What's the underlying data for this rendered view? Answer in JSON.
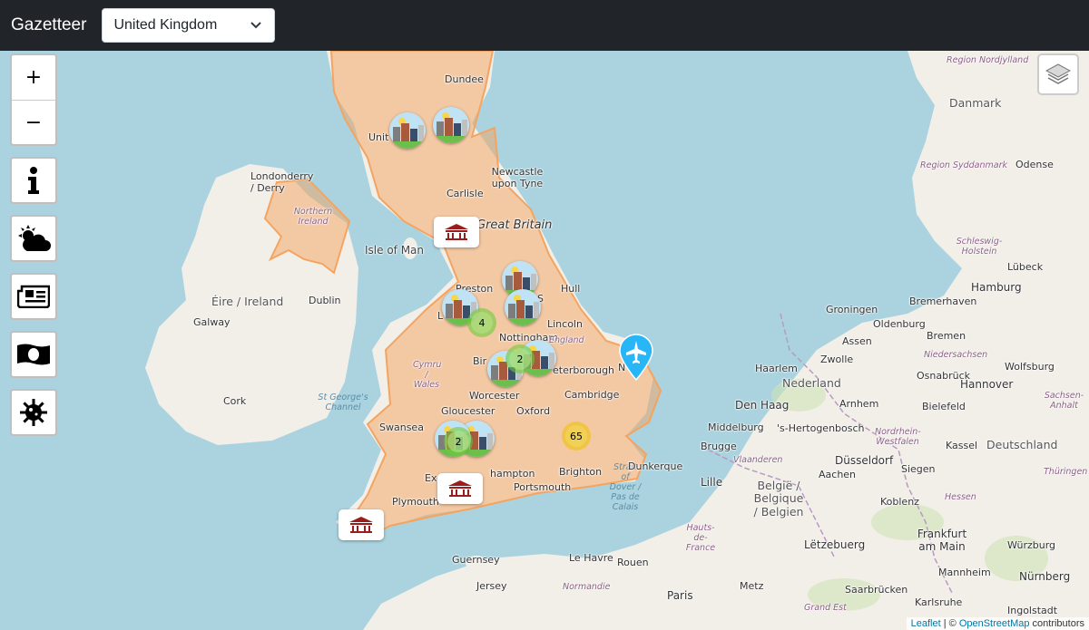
{
  "navbar": {
    "brand": "Gazetteer",
    "country_selected": "United Kingdom"
  },
  "controls": {
    "zoom_in": "+",
    "zoom_out": "−"
  },
  "labels": {
    "dundee": "Dundee",
    "newcastle": "Newcastle upon Tyne",
    "carlisle": "Carlisle",
    "great_britain": "Great Britain",
    "isle_of_man": "Isle of Man",
    "preston": "Preston",
    "sheffield": "S",
    "hull": "Hull",
    "lincoln": "Lincoln",
    "england": "England",
    "nottingham": "Nottingham",
    "peterborough": "eterborough",
    "birmingham": "Bir",
    "worcester": "Worcester",
    "cambridge": "Cambridge",
    "gloucester": "Gloucester",
    "oxford": "Oxford",
    "swansea": "Swansea",
    "exeter": "Exe",
    "southampton": "hampton",
    "portsmouth": "Portsmouth",
    "brighton": "Brighton",
    "plymouth": "Plymouth",
    "cymru": "Cymru / Wales",
    "united_kingdom_partial": "Unit",
    "leeds_partial": "L",
    "londonderry": "Londonderry / Derry",
    "northern_ireland": "Northern Ireland",
    "eire": "Éire / Ireland",
    "dublin": "Dublin",
    "galway": "Galway",
    "cork": "Cork",
    "st_georges": "St George's Channel",
    "strait_dover": "Strait of Dover / Pas de Calais",
    "guernsey": "Guernsey",
    "jersey": "Jersey",
    "norwich": "N",
    "region_nord": "Region Nordjylland",
    "danmark": "Danmark",
    "region_syddanmark": "Region Syddanmark",
    "odense": "Odense",
    "schleswig": "Schleswig-Holstein",
    "lubeck": "Lübeck",
    "hamburg": "Hamburg",
    "bremerhaven": "Bremerhaven",
    "groningen": "Groningen",
    "oldenburg": "Oldenburg",
    "bremen": "Bremen",
    "assen": "Assen",
    "niedersachsen": "Niedersachsen",
    "zwolle": "Zwolle",
    "wolfsburg": "Wolfsburg",
    "haarlem": "Haarlem",
    "nederland": "Nederland",
    "osnabruck": "Osnabrück",
    "hannover": "Hannover",
    "den_haag": "Den Haag",
    "arnhem": "Arnhem",
    "bielefeld": "Bielefeld",
    "sachsen_anhalt": "Sachsen-Anhalt",
    "middelburg": "Middelburg",
    "hertogenbosch": "'s-Hertogenbosch",
    "nordrhein": "Nordrhein-Westfalen",
    "kassel": "Kassel",
    "deutschland": "Deutschland",
    "brugge": "Brugge",
    "vlaanderen": "Vlaanderen",
    "aachen": "Aachen",
    "dusseldorf": "Düsseldorf",
    "siegen": "Siegen",
    "thuringen": "Thüringen",
    "dunkerque": "Dunkerque",
    "lille": "Lille",
    "belgique": "België / Belgique / Belgien",
    "koblenz": "Koblenz",
    "hessen": "Hessen",
    "letzebuerg": "Lëtzebuerg",
    "frankfurt": "Frankfurt am Main",
    "hauts_de_france": "Hauts-de-France",
    "mannheim": "Mannheim",
    "wurzburg": "Würzburg",
    "nurnberg": "Nürnberg",
    "le_havre": "Le Havre",
    "rouen": "Rouen",
    "normandie": "Normandie",
    "paris": "Paris",
    "metz": "Metz",
    "grand_est": "Grand Est",
    "saarbrucken": "Saarbrücken",
    "karlsruhe": "Karlsruhe",
    "ingolstadt": "Ingolstadt"
  },
  "clusters": {
    "midlands": "4",
    "east": "2",
    "wales": "2",
    "london": "65"
  },
  "attribution": {
    "leaflet": "Leaflet",
    "sep": " | © ",
    "osm": "OpenStreetMap",
    "contrib": " contributors"
  },
  "colors": {
    "sea": "#aad3df",
    "land": "#f2efe9",
    "highlight": "#f4a460",
    "navbar": "#212529"
  }
}
